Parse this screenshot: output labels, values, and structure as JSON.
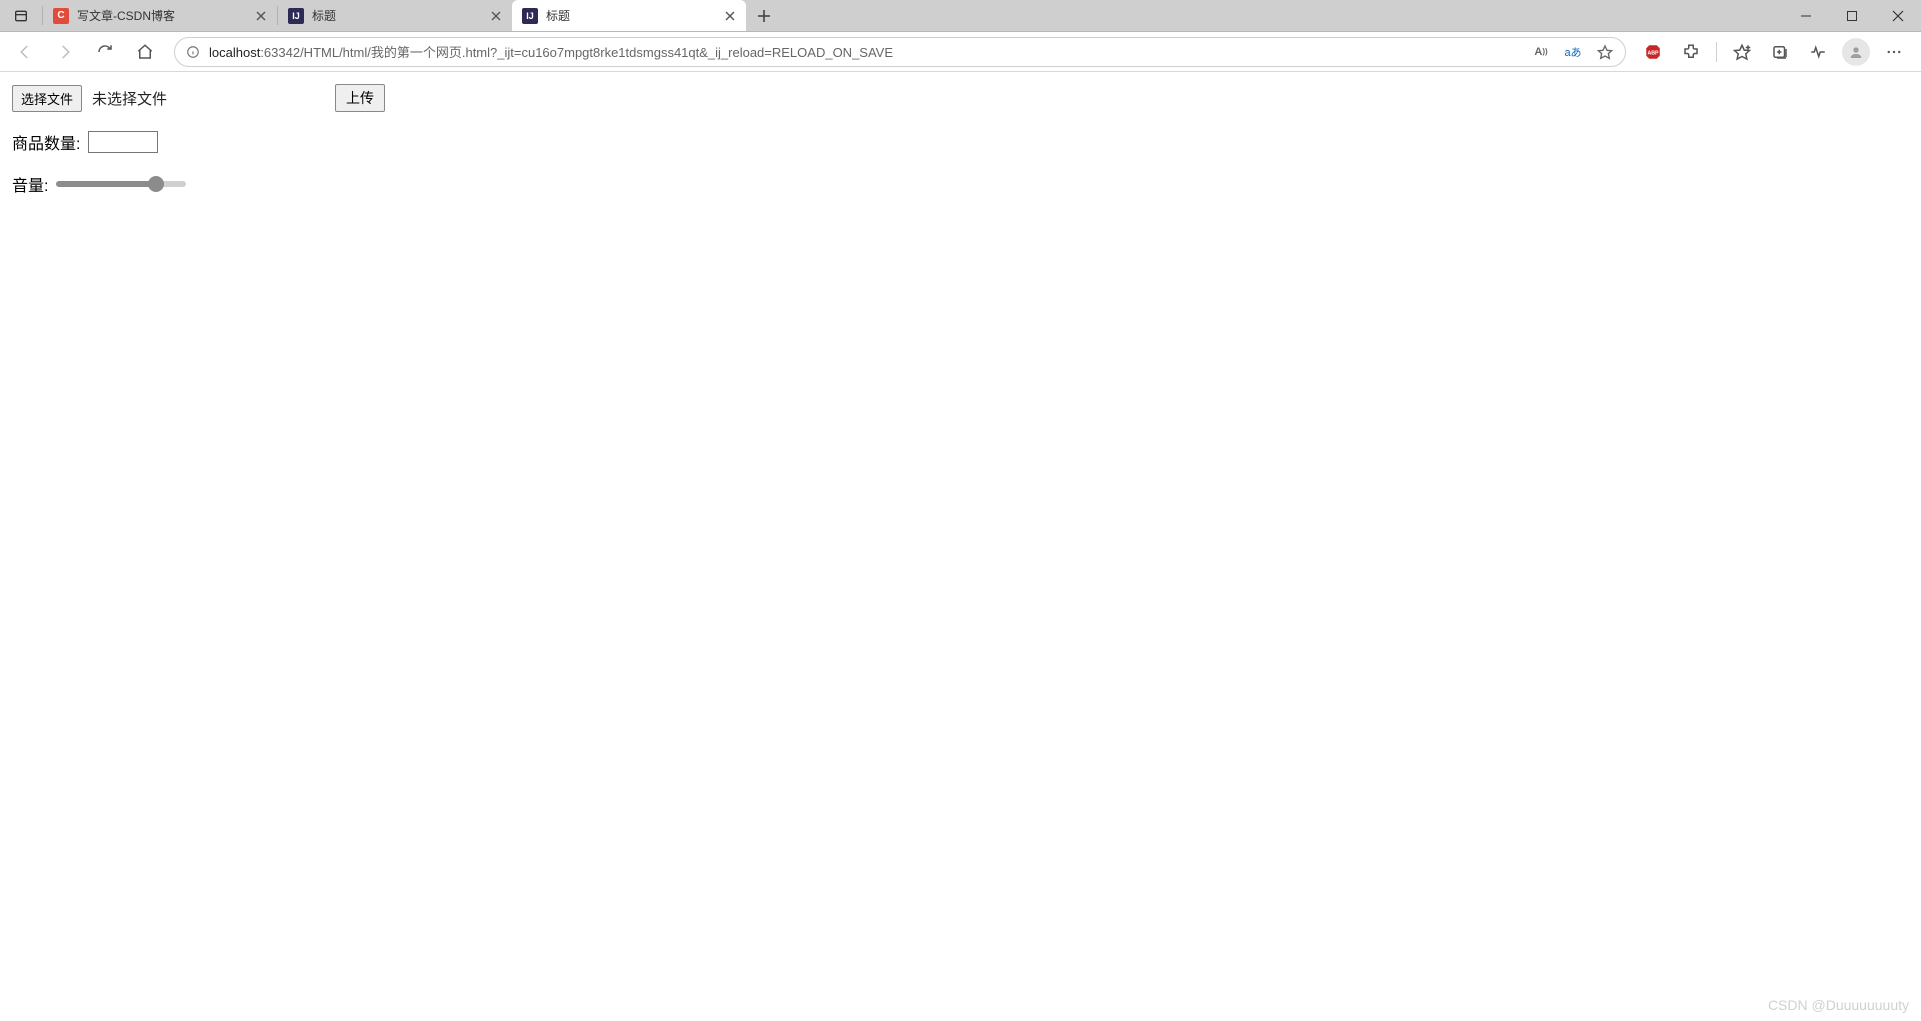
{
  "browser": {
    "tabs": [
      {
        "title": "写文章-CSDN博客",
        "favicon": "csdn",
        "active": false
      },
      {
        "title": "标题",
        "favicon": "ij",
        "active": false
      },
      {
        "title": "标题",
        "favicon": "ij",
        "active": true
      }
    ],
    "address": {
      "host": "localhost",
      "rest": ":63342/HTML/html/我的第一个网页.html?_ijt=cu16o7mpgt8rke1tdsmgss41qt&_ij_reload=RELOAD_ON_SAVE"
    },
    "translate_label": "aあ"
  },
  "page": {
    "file_choose_label": "选择文件",
    "file_status": "未选择文件",
    "upload_label": "上传",
    "quantity_label": "商品数量:",
    "quantity_value": "",
    "volume_label": "音量:",
    "volume_value": 80,
    "volume_min": 0,
    "volume_max": 100
  },
  "watermark": "CSDN @Duuuuuuuuty"
}
